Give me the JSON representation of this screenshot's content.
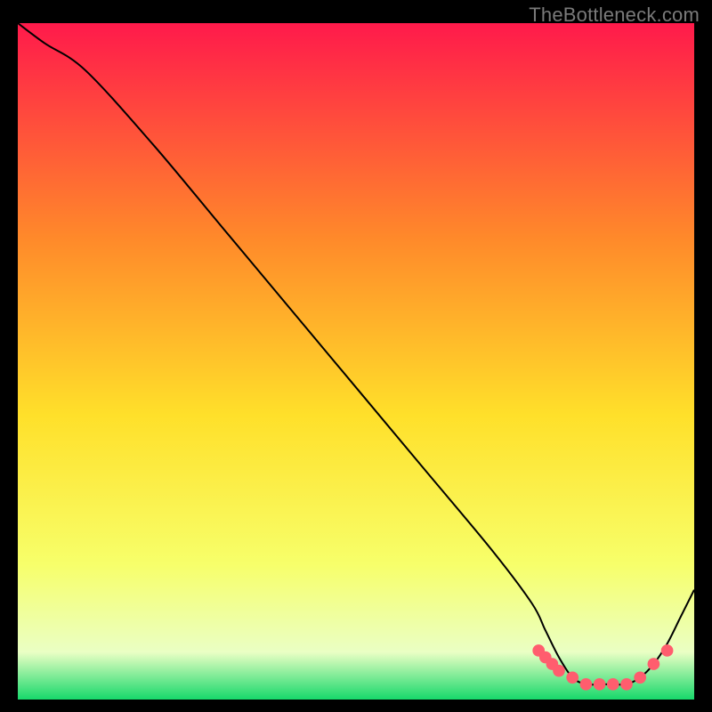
{
  "watermark": "TheBottleneck.com",
  "colors": {
    "top": "#ff1a4b",
    "mid_upper": "#ff8a2a",
    "mid": "#ffe02a",
    "mid_lower": "#f7ff6a",
    "pale": "#eaffc4",
    "bottom": "#17d86b",
    "line": "#000000",
    "dots": "#ff5d6e"
  },
  "chart_data": {
    "type": "line",
    "title": "",
    "xlabel": "",
    "ylabel": "",
    "xlim": [
      0,
      100
    ],
    "ylim": [
      0,
      100
    ],
    "series": [
      {
        "name": "curve",
        "x": [
          0,
          4,
          10,
          20,
          30,
          40,
          50,
          60,
          70,
          76,
          78,
          80,
          82,
          84,
          86,
          88,
          90,
          92,
          94,
          96,
          98,
          100
        ],
        "y": [
          100,
          97,
          93,
          82,
          70,
          58,
          46,
          34,
          22,
          14,
          10,
          6,
          3,
          2,
          2,
          2,
          2,
          3,
          5,
          8,
          12,
          16
        ]
      }
    ],
    "dots": {
      "name": "highlight-dots",
      "points": [
        {
          "x": 77,
          "y": 7
        },
        {
          "x": 78,
          "y": 6
        },
        {
          "x": 79,
          "y": 5
        },
        {
          "x": 80,
          "y": 4
        },
        {
          "x": 82,
          "y": 3
        },
        {
          "x": 84,
          "y": 2
        },
        {
          "x": 86,
          "y": 2
        },
        {
          "x": 88,
          "y": 2
        },
        {
          "x": 90,
          "y": 2
        },
        {
          "x": 92,
          "y": 3
        },
        {
          "x": 94,
          "y": 5
        },
        {
          "x": 96,
          "y": 7
        }
      ]
    }
  }
}
